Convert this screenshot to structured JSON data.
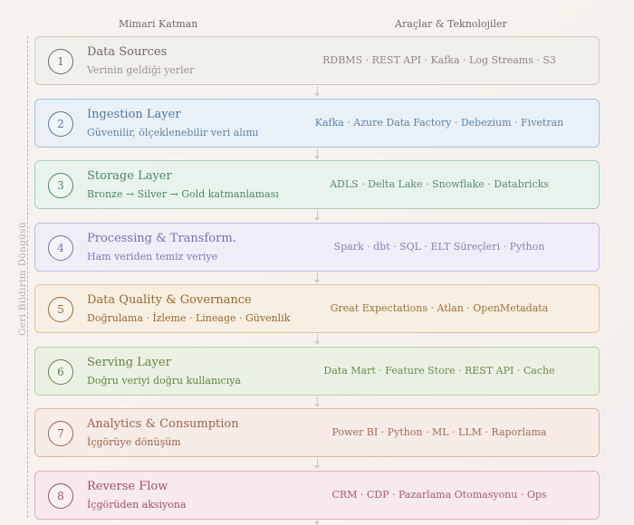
{
  "headers": {
    "left": "Mimari Katman",
    "right": "Araçlar & Teknolojiler"
  },
  "feedback_label": "Geri Bildirim Döngüsü",
  "layers": [
    {
      "num": "1",
      "title": "Data Sources",
      "sub": "Verinin geldiği yerler",
      "tools": "RDBMS · REST API · Kafka · Log Streams · S3",
      "colors": {
        "bg": "#f1efec",
        "border": "#cfcbc5",
        "title": "#6e6a65",
        "sub": "#9a958f",
        "tools": "#8f8a85"
      }
    },
    {
      "num": "2",
      "title": "Ingestion Layer",
      "sub": "Güvenilir, ölçeklenebilir veri alımı",
      "tools": "Kafka · Azure Data Factory · Debezium · Fivetran",
      "colors": {
        "bg": "#e9f0f8",
        "border": "#a9c3dd",
        "title": "#4f7aa6",
        "sub": "#5f85ad",
        "tools": "#5f85ad"
      }
    },
    {
      "num": "3",
      "title": "Storage Layer",
      "sub": "Bronze → Silver → Gold katmanlaması",
      "tools": "ADLS · Delta Lake · Snowflake · Databricks",
      "colors": {
        "bg": "#e7f3ec",
        "border": "#a8cfb7",
        "title": "#4b8a64",
        "sub": "#4b8a64",
        "tools": "#5a8f6f"
      }
    },
    {
      "num": "4",
      "title": "Processing & Transform.",
      "sub": "Ham veriden temiz veriye",
      "tools": "Spark · dbt · SQL · ELT Süreçleri · Python",
      "colors": {
        "bg": "#eeedf8",
        "border": "#c0bde2",
        "title": "#7a70b5",
        "sub": "#857bbd",
        "tools": "#8a82bd"
      }
    },
    {
      "num": "5",
      "title": "Data Quality & Governance",
      "sub": "Doğrulama · İzleme · Lineage · Güvenlik",
      "tools": "Great Expectations · Atlan · OpenMetadata",
      "colors": {
        "bg": "#f8eee1",
        "border": "#e1c6a0",
        "title": "#9a6a2e",
        "sub": "#9a6a2e",
        "tools": "#a0733a"
      }
    },
    {
      "num": "6",
      "title": "Serving Layer",
      "sub": "Doğru veriyi doğru kullanıcıya",
      "tools": "Data Mart · Feature Store · REST API · Cache",
      "colors": {
        "bg": "#eaf1e2",
        "border": "#b8d1a0",
        "title": "#5f8640",
        "sub": "#5f8640",
        "tools": "#6a8d4e"
      }
    },
    {
      "num": "7",
      "title": "Analytics & Consumption",
      "sub": "İçgörüye dönüşüm",
      "tools": "Power BI · Python · ML · LLM · Raporlama",
      "colors": {
        "bg": "#f6ebe6",
        "border": "#ddb7a6",
        "title": "#a3614a",
        "sub": "#a3614a",
        "tools": "#a86c55"
      }
    },
    {
      "num": "8",
      "title": "Reverse Flow",
      "sub": "İçgörüden aksiyona",
      "tools": "CRM · CDP · Pazarlama Otomasyonu · Ops",
      "colors": {
        "bg": "#f7e9ed",
        "border": "#deb1bf",
        "title": "#a54f6a",
        "sub": "#a54f6a",
        "tools": "#ab5c75"
      }
    }
  ]
}
